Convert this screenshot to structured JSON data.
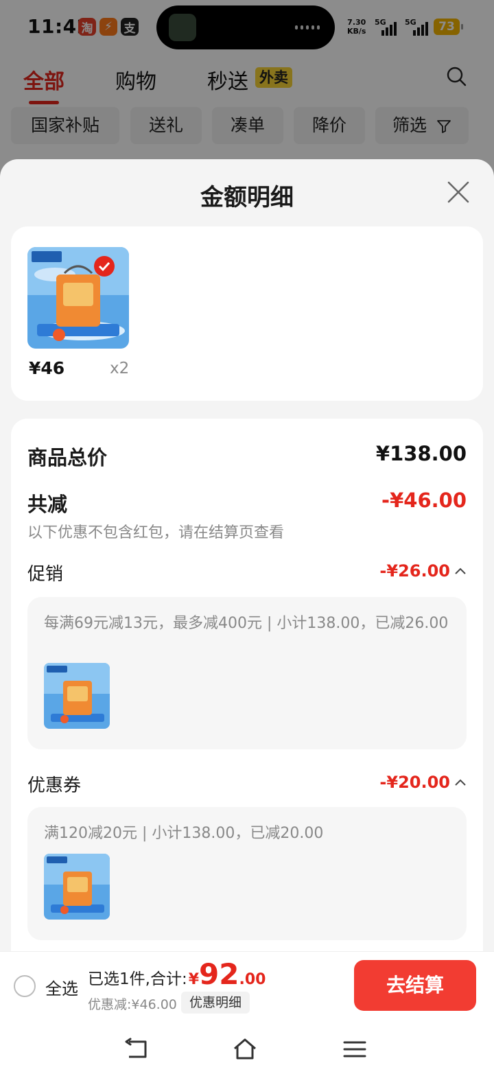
{
  "status_bar": {
    "time": "11:42",
    "app_icons": [
      "淘",
      "⚡",
      "支"
    ],
    "net_speed": "7.30",
    "net_unit": "KB/s",
    "signal1": "5G",
    "signal2": "5G",
    "battery": "73"
  },
  "top_nav": {
    "tabs": [
      "全部",
      "购物",
      "秒送"
    ],
    "waimai_tag": "外卖"
  },
  "filters": [
    "国家补贴",
    "送礼",
    "凑单",
    "降价",
    "筛选"
  ],
  "sheet": {
    "title": "金额明细",
    "item": {
      "price": "¥46",
      "qty": "x2"
    },
    "total_label": "商品总价",
    "total_value": "¥138.00",
    "reduce_label": "共减",
    "reduce_value": "-¥46.00",
    "note": "以下优惠不包含红包，请在结算页查看",
    "promo": {
      "label": "促销",
      "value": "-¥26.00",
      "desc": "每满69元减13元，最多减400元 | 小计138.00，已减26.00"
    },
    "coupon": {
      "label": "优惠券",
      "value": "-¥20.00",
      "desc": "满120减20元 | 小计138.00，已减20.00"
    }
  },
  "footer": {
    "select_all": "全选",
    "selected_text": "已选1件,合计:",
    "currency": "¥",
    "total_int": "92",
    "total_dec": ".00",
    "discount_text": "优惠减:¥46.00",
    "detail_button": "优惠明细",
    "checkout_button": "去结算"
  },
  "colors": {
    "accent_red": "#e4261c",
    "checkout_red": "#f23c32",
    "waimai_yellow": "#f7d335"
  }
}
